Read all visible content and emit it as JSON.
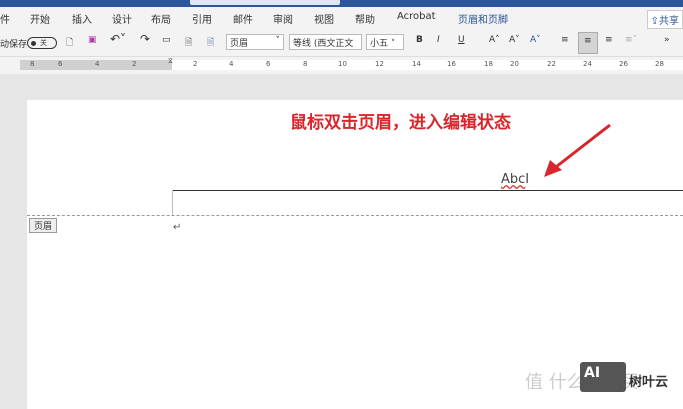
{
  "tabs": [
    "件",
    "开始",
    "插入",
    "设计",
    "布局",
    "引用",
    "邮件",
    "审阅",
    "视图",
    "帮助",
    "Acrobat",
    "页眉和页脚"
  ],
  "share_label": "共享",
  "toolbar": {
    "autosave": "动保存",
    "toggle_state": "关",
    "style": "页眉",
    "font": "等线 (西文正文",
    "size": "小五",
    "bold": "B",
    "italic": "I",
    "underline": "U",
    "more": "»"
  },
  "ruler": [
    "8",
    "6",
    "4",
    "2",
    "2",
    "4",
    "6",
    "8",
    "10",
    "12",
    "14",
    "16",
    "18",
    "20",
    "22",
    "24",
    "26",
    "28"
  ],
  "document": {
    "instruction": "鼠标双击页眉，进入编辑状态",
    "header_text": "Abc",
    "header_label": "页眉",
    "paragraph_mark": "↵"
  },
  "watermark": {
    "logo": "AI",
    "brand": "树叶云",
    "bg_text": "值 什么值得买"
  },
  "colors": {
    "accent": "#2b579a",
    "annotation": "#d9262c"
  }
}
